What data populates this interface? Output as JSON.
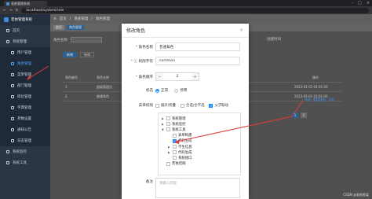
{
  "browser": {
    "tab_title": "若依管理系统",
    "url": "localhost/system/role",
    "window_controls": [
      "-",
      "□",
      "×"
    ]
  },
  "sidebar": {
    "brand": "若依管理系统",
    "items": [
      {
        "label": "首页"
      },
      {
        "label": "系统管理"
      },
      {
        "label": "用户管理"
      },
      {
        "label": "角色管理"
      },
      {
        "label": "菜单管理"
      },
      {
        "label": "部门管理"
      },
      {
        "label": "岗位管理"
      },
      {
        "label": "字典管理"
      },
      {
        "label": "参数设置"
      },
      {
        "label": "通知公告"
      },
      {
        "label": "日志管理"
      },
      {
        "label": "系统监控"
      },
      {
        "label": "系统工具"
      }
    ]
  },
  "topbar": {
    "breadcrumb": [
      "首页",
      "系统管理",
      "角色管理"
    ]
  },
  "tags": [
    {
      "label": "首页"
    },
    {
      "label": "角色管理"
    }
  ],
  "background": {
    "form_label": "角色名称",
    "right_labels": [
      "创建时间"
    ],
    "buttons": [
      "新增",
      "修改"
    ],
    "table_headers": [
      "角色编号",
      "角色名称"
    ],
    "rows": [
      {
        "id": "1",
        "name": "超级管理员",
        "time": "2023-01-01 01:01:00"
      },
      {
        "id": "2",
        "name": "普通角色",
        "time": "2023-01-01 01:01:00"
      }
    ],
    "row_actions": [
      "修改",
      "数据权限",
      "分配"
    ],
    "pager": [
      "1",
      "2"
    ],
    "op_header": "操作"
  },
  "modal": {
    "title": "修改角色",
    "close_label": "×",
    "role_name_label": "角色名称",
    "role_name_value": "普通角色",
    "perm_label": "权限字符",
    "perm_value": "common",
    "sort_label": "角色顺序",
    "sort_value": "2",
    "minus": "−",
    "plus": "+",
    "status_label": "状态",
    "status_options": [
      {
        "label": "正常",
        "checked": true
      },
      {
        "label": "停用",
        "checked": false
      }
    ],
    "menu_perm_label": "菜单权限",
    "menu_perm_options": [
      {
        "label": "展开/折叠",
        "checked": false
      },
      {
        "label": "全选/全不选",
        "checked": false
      },
      {
        "label": "父子联动",
        "checked": true
      }
    ],
    "tree": [
      {
        "label": "系统管理",
        "level": 0,
        "expandable": true,
        "checked": false
      },
      {
        "label": "系统监控",
        "level": 0,
        "expandable": true,
        "checked": false
      },
      {
        "label": "系统工具",
        "level": 0,
        "expandable": true,
        "checked": false
      },
      {
        "label": "表单构建",
        "level": 1,
        "expandable": false,
        "checked": false
      },
      {
        "label": "代码生成",
        "level": 1,
        "expandable": false,
        "checked": true
      },
      {
        "label": "学生信息",
        "level": 1,
        "expandable": true,
        "checked": false
      },
      {
        "label": "代码生成",
        "level": 1,
        "expandable": true,
        "checked": false
      },
      {
        "label": "系统接口",
        "level": 1,
        "expandable": false,
        "checked": false
      },
      {
        "label": "若依官网",
        "level": 0,
        "expandable": false,
        "checked": false
      }
    ],
    "remark_label": "备注",
    "remark_placeholder": "请输入内容"
  },
  "watermark": "CSDN @若依框架",
  "colors": {
    "accent": "#1890ff",
    "sidebar": "#2a3545",
    "arrow": "#e53935"
  }
}
